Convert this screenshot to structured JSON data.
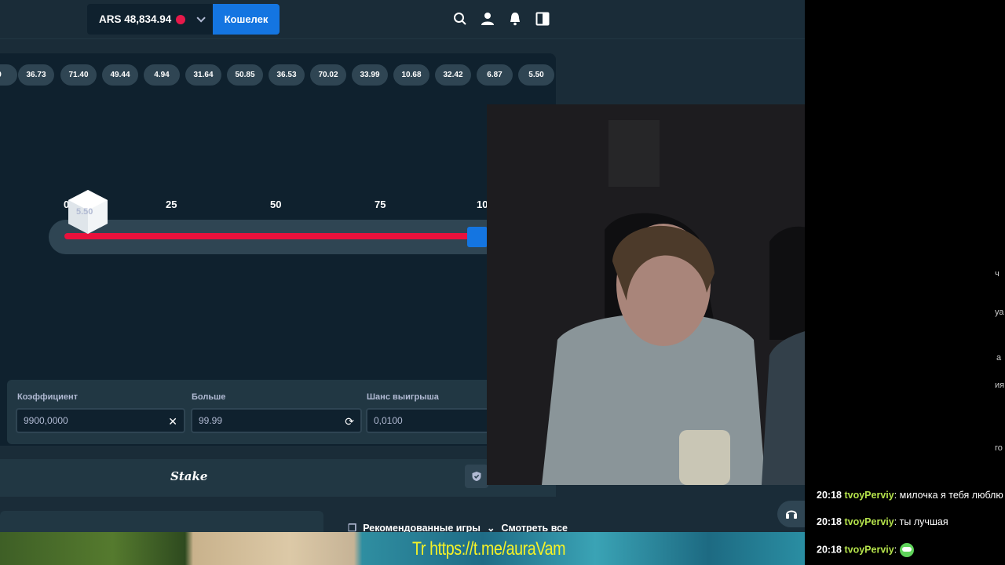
{
  "header": {
    "balance": "ARS 48,834.94",
    "wallet_label": "Кошелек",
    "icons": [
      "search-icon",
      "user-icon",
      "bell-icon",
      "sidebar-toggle-icon"
    ]
  },
  "results": {
    "partial_first": "0",
    "values": [
      "36.73",
      "71.40",
      "49.44",
      "4.94",
      "31.64",
      "50.85",
      "36.53",
      "70.02",
      "33.99",
      "10.68",
      "32.42",
      "6.87",
      "5.50"
    ]
  },
  "slider": {
    "ticks": [
      "25",
      "50",
      "75",
      "10"
    ],
    "dice_value": "5.50",
    "first_tick_partial": "0"
  },
  "controls": {
    "multiplier_label": "Коэффициент",
    "multiplier_value": "9900,0000",
    "over_label": "Больше",
    "over_value": "99.99",
    "chance_label": "Шанс выигрыша",
    "chance_value": "0,0100"
  },
  "footer": {
    "logo": "Stake"
  },
  "recommended": {
    "label": "Рекомендованные игры",
    "see_all": "Смотреть все"
  },
  "banner": {
    "text": "Tr https://t.me/auraVam"
  },
  "chat": {
    "messages": [
      {
        "time": "20:18",
        "user": "tvoyPerviy",
        "text": "милочка я тебя люблю"
      },
      {
        "time": "20:18",
        "user": "tvoyPerviy",
        "text": "ты лучшая"
      },
      {
        "time": "20:18",
        "user": "tvoyPerviy",
        "text": ""
      }
    ],
    "edge_fragments": [
      "ч",
      "уа",
      "а",
      "ия",
      "го"
    ]
  },
  "colors": {
    "bg": "#1a2c38",
    "panel": "#0f212e",
    "accent_blue": "#1475e1",
    "slider_red": "#e9113c",
    "chat_user": "#b5e34b",
    "banner_text": "#f5f227"
  }
}
